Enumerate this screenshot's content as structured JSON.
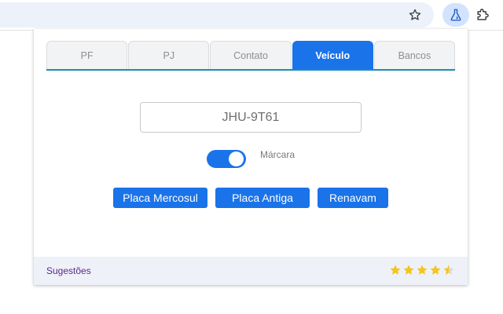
{
  "browser": {
    "icons": [
      "star-icon",
      "flask-icon",
      "puzzle-icon"
    ]
  },
  "popup": {
    "tabs": [
      {
        "label": "PF",
        "active": false
      },
      {
        "label": "PJ",
        "active": false
      },
      {
        "label": "Contato",
        "active": false
      },
      {
        "label": "Veículo",
        "active": true
      },
      {
        "label": "Bancos",
        "active": false
      }
    ],
    "plate_value": "JHU-9T61",
    "toggle": {
      "label": "Márcara",
      "on": true
    },
    "buttons": {
      "mercosul": "Placa Mercosul",
      "antiga": "Placa Antiga",
      "renavam": "Renavam"
    },
    "footer": {
      "suggestions": "Sugestões",
      "rating": 4.5,
      "rating_max": 5
    }
  },
  "colors": {
    "accent": "#1a73e8",
    "star": "#f6c41b",
    "suggestion_link": "#5b2a86"
  }
}
